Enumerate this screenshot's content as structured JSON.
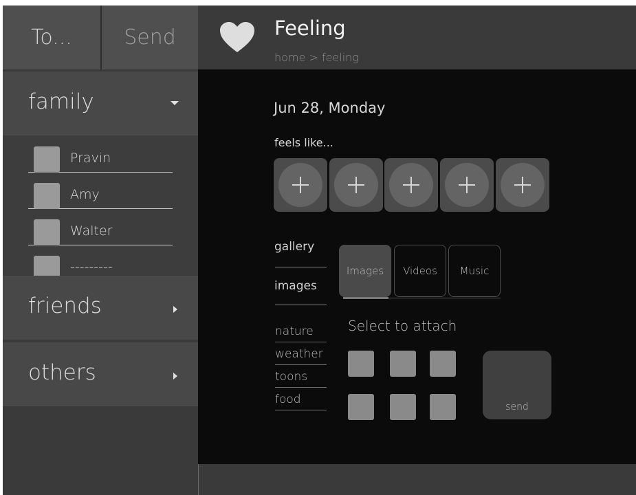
{
  "sidebar": {
    "to_label": "To...",
    "send_label": "Send",
    "groups": [
      {
        "label": "family",
        "expanded": true
      },
      {
        "label": "friends",
        "expanded": false
      },
      {
        "label": "others",
        "expanded": false
      }
    ],
    "contacts": [
      {
        "name": "Pravin"
      },
      {
        "name": "Amy"
      },
      {
        "name": "Walter"
      },
      {
        "name": "---------"
      }
    ]
  },
  "header": {
    "title": "Feeling",
    "breadcrumb": "home > feeling",
    "icon": "heart-icon"
  },
  "main": {
    "date": "Jun 28, Monday",
    "feels_label": "feels like...",
    "feel_slots": [
      {
        "icon": "plus-icon"
      },
      {
        "icon": "plus-icon"
      },
      {
        "icon": "plus-icon"
      },
      {
        "icon": "plus-icon"
      },
      {
        "icon": "plus-icon"
      }
    ],
    "menu": {
      "gallery": "gallery",
      "images": "images",
      "sub_items": [
        "nature",
        "weather",
        "toons",
        "food"
      ]
    },
    "tabs": [
      "Images",
      "Videos",
      "Music"
    ],
    "active_tab": "Images",
    "attach_label": "Select to attach",
    "send_label": "send"
  },
  "colors": {
    "sidebar_bg": "#3a3a3a",
    "header_bg": "#3a3a3a",
    "main_bg": "#0b0b0b",
    "accent_text": "#f2f2f2"
  }
}
